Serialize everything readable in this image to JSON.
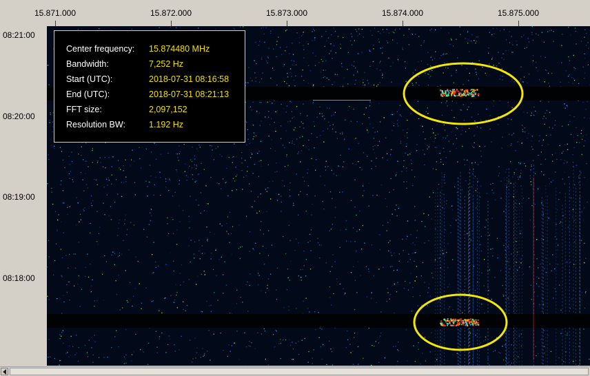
{
  "frequency_axis": {
    "ticks": [
      "15.871.000",
      "15.872.000",
      "15.873.000",
      "15.874.000",
      "15.875.000"
    ]
  },
  "time_axis": {
    "ticks": [
      "08:21:00",
      "08:20:00",
      "08:19:00",
      "08:18:00"
    ]
  },
  "info": {
    "rows": [
      {
        "key": "Center frequency:",
        "value": "15.874480 MHz"
      },
      {
        "key": "Bandwidth:",
        "value": "7,252 Hz"
      },
      {
        "key": "Start (UTC):",
        "value": "2018-07-31 08:16:58"
      },
      {
        "key": "End (UTC):",
        "value": "2018-07-31 08:21:13"
      },
      {
        "key": "FFT size:",
        "value": "2,097,152"
      },
      {
        "key": "Resolution BW:",
        "value": "1.192 Hz"
      }
    ]
  },
  "colors": {
    "waterfall_background": "#020a1a",
    "highlight_ellipse": "#f5e800",
    "info_value": "#f0e000",
    "info_key": "#ffffff",
    "signal_hot": "#ff3a10",
    "signal_warm": "#ffd020",
    "signal_cool": "#20c0ff",
    "noise_speckle": "#4080ff"
  },
  "icons": {
    "scroll_left": "triangle-left-icon"
  }
}
